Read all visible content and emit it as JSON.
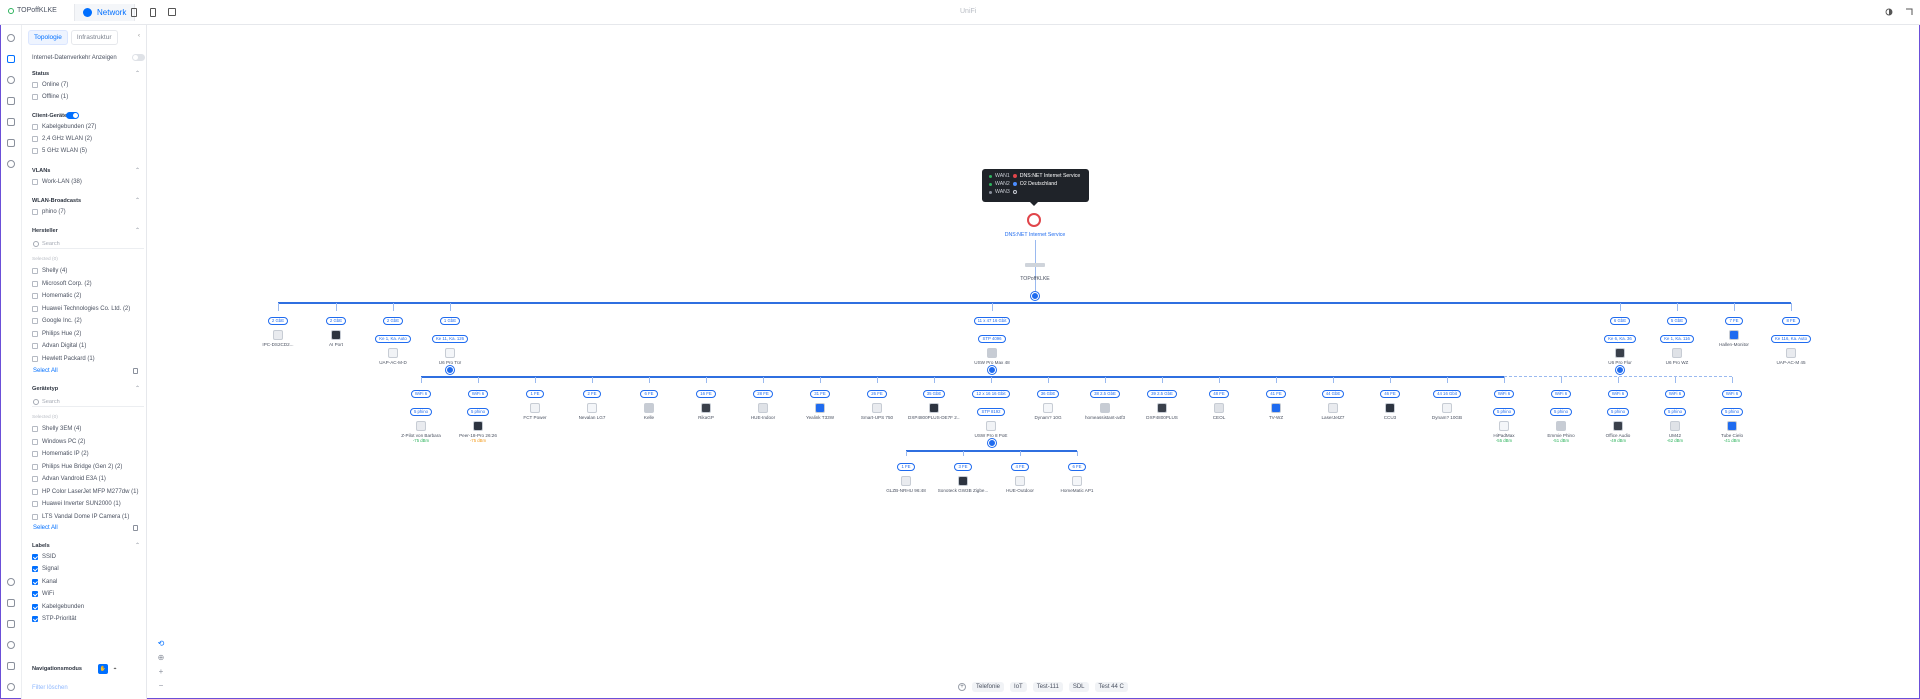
{
  "topbar": {
    "site_name": "TOPoffKLKE",
    "app_name": "Network",
    "center_title": "UniFi"
  },
  "panel": {
    "tabs": [
      "Topologie",
      "Infrastruktur"
    ],
    "internet_traffic_label": "Internet-Datenverkehr Anzeigen",
    "sections": {
      "status": {
        "title": "Status",
        "items": [
          "Online (7)",
          "Offline (1)"
        ]
      },
      "clients": {
        "title": "Client-Geräte",
        "items": [
          "Kabelgebunden (27)",
          "2,4 GHz WLAN (2)",
          "5 GHz WLAN (5)"
        ]
      },
      "vlans": {
        "title": "VLANs",
        "items": [
          "Work-LAN (38)"
        ]
      },
      "wlan": {
        "title": "WLAN-Broadcasts",
        "items": [
          "phino (7)"
        ]
      },
      "manufacturer": {
        "title": "Hersteller",
        "search_placeholder": "Search",
        "selected": "Selected (0)",
        "items": [
          "Shelly (4)",
          "Microsoft Corp. (2)",
          "Homematic (2)",
          "Huawei Technologies Co. Ltd. (2)",
          "Google Inc. (2)",
          "Philips Hue (2)",
          "Advan Digital (1)",
          "Hewlett Packard (1)"
        ],
        "select_all": "Select All"
      },
      "devicetype": {
        "title": "Gerätetyp",
        "search_placeholder": "Search",
        "selected": "Selected (0)",
        "items": [
          "Shelly 3EM (4)",
          "Windows PC (2)",
          "Homematic IP (2)",
          "Philips Hue Bridge (Gen 2) (2)",
          "Advan Vandroid E3A (1)",
          "HP Color LaserJet MFP M277dw (1)",
          "Huawei Inverter SUN2000 (1)",
          "LTS Vandal Dome IP Camera (1)"
        ],
        "select_all": "Select All"
      },
      "labels": {
        "title": "Labels",
        "items": [
          "SSID",
          "Signal",
          "Kanal",
          "WiFi",
          "Kabelgebunden",
          "STP-Priorität"
        ]
      }
    },
    "nav_mode_label": "Navigationsmodus",
    "filter_clear": "Filter löschen"
  },
  "wan": {
    "rows": [
      {
        "key": "WAN1",
        "value": "DNS:NET Internet Service"
      },
      {
        "key": "WAN2",
        "value": "O2 Deutschland"
      },
      {
        "key": "WAN3",
        "value": ""
      }
    ],
    "isp_name": "DNS:NET Internet Service",
    "gateway_name": "TOPoffKLKE"
  },
  "tier1": [
    {
      "pills": [
        "2 GbE"
      ],
      "name": "IPC-DS2CD2...",
      "sig": ""
    },
    {
      "pills": [
        "2 GbE"
      ],
      "name": "AI Port",
      "sig": ""
    },
    {
      "pills": [
        "2 GbE",
        "Ke 1, Ka. Auto"
      ],
      "name": "UAP-AC-M-D",
      "sig": ""
    },
    {
      "pills": [
        "1 GbE",
        "Ke 11, Ka. 126"
      ],
      "name": "U6 Pro Tür",
      "sig": ""
    },
    {
      "pills": [
        "11 x 47 16 Gbit",
        "STP 4096"
      ],
      "name": "USW Pro Max 48",
      "sig": ""
    },
    {
      "pills": [
        "6 GbE",
        "Ke 6, Ka. 36"
      ],
      "name": "U6 Pro Flur",
      "sig": ""
    },
    {
      "pills": [
        "5 GbE",
        "Ke 1, Ka. 116"
      ],
      "name": "U6 Pro WZ",
      "sig": ""
    },
    {
      "pills": [
        "7 FE"
      ],
      "name": "Hallen-Monitor",
      "sig": ""
    },
    {
      "pills": [
        "8 FE",
        "Ke 116, Ka. Auto"
      ],
      "name": "UAP-AC-M 45",
      "sig": ""
    }
  ],
  "tier2": [
    {
      "pills": [
        "WiFi 6",
        "5 phino"
      ],
      "name": "Z-Pilot von Barbara",
      "sig": "-75 dBm",
      "sig_color": "green"
    },
    {
      "pills": [
        "WiFi 6",
        "5 phino"
      ],
      "name": "Peer-18-Pro 26:26",
      "sig": "-75 dBm",
      "sig_color": "orange"
    },
    {
      "pills": [
        "1 FE"
      ],
      "name": "FCT Power",
      "sig": ""
    },
    {
      "pills": [
        "2 FE"
      ],
      "name": "Nevalan LG7",
      "sig": ""
    },
    {
      "pills": [
        "6 FE"
      ],
      "name": "Kelle",
      "sig": ""
    },
    {
      "pills": [
        "16 FE"
      ],
      "name": "RikaGP",
      "sig": ""
    },
    {
      "pills": [
        "28 FE"
      ],
      "name": "HUE-Indoor",
      "sig": ""
    },
    {
      "pills": [
        "31 FE"
      ],
      "name": "Yealink T33W",
      "sig": ""
    },
    {
      "pills": [
        "26 FE"
      ],
      "name": "Smart-UPS 750",
      "sig": ""
    },
    {
      "pills": [
        "35 GbE"
      ],
      "name": "DXP4800PLUS-DE7F 2...",
      "sig": ""
    },
    {
      "pills": [
        "12 x 16 16 Gbit",
        "STP 8192"
      ],
      "name": "USW Pro 8 PoE",
      "sig": ""
    },
    {
      "pills": [
        "36 GbE"
      ],
      "name": "Dynam? 10G",
      "sig": ""
    },
    {
      "pills": [
        "38 2.5 GbE"
      ],
      "name": "homeassistant-a4f3",
      "sig": ""
    },
    {
      "pills": [
        "39 2.5 GbE"
      ],
      "name": "DXP4800PLUS",
      "sig": ""
    },
    {
      "pills": [
        "48 FE"
      ],
      "name": "CEOL",
      "sig": ""
    },
    {
      "pills": [
        "41 FE"
      ],
      "name": "TV-WZ",
      "sig": ""
    },
    {
      "pills": [
        "44 GbE"
      ],
      "name": "LaserJetZ7",
      "sig": ""
    },
    {
      "pills": [
        "46 FE"
      ],
      "name": "CCU3",
      "sig": ""
    },
    {
      "pills": [
        "44 16 Gbit"
      ],
      "name": "Dynam? 10GB",
      "sig": ""
    },
    {
      "pills": [
        "WiFi 6",
        "5 phino"
      ],
      "name": "HiPadMax",
      "sig": "-55 dBm",
      "sig_color": "green"
    },
    {
      "pills": [
        "WiFi 6",
        "5 phino"
      ],
      "name": "Emmie Phino",
      "sig": "-51 dBm",
      "sig_color": "green"
    },
    {
      "pills": [
        "WiFi 6",
        "5 phino"
      ],
      "name": "Office Audio",
      "sig": "-49 dBm",
      "sig_color": "green"
    },
    {
      "pills": [
        "WiFi 6",
        "5 phino"
      ],
      "name": "UM42",
      "sig": "-62 dBm",
      "sig_color": "green"
    },
    {
      "pills": [
        "WiFi 6",
        "5 phino"
      ],
      "name": "Tube Cielo",
      "sig": "-41 dBm",
      "sig_color": "green"
    }
  ],
  "tier3": [
    {
      "pills": [
        "1 FE"
      ],
      "name": "GLZB-NRHU 96:48"
    },
    {
      "pills": [
        "3 FE"
      ],
      "name": "Sonoteck GW3B Zigbe..."
    },
    {
      "pills": [
        "4 FE"
      ],
      "name": "HUE-Outdoor"
    },
    {
      "pills": [
        "6 FE"
      ],
      "name": "HomeMatic AP1"
    }
  ],
  "bottombar": [
    "Telefonie",
    "IoT",
    "Test-111",
    "SDL",
    "Test 44 C"
  ],
  "colors": {
    "accent": "#006fff",
    "line": "#2f6fe0",
    "signal_good": "#2db35d",
    "signal_warn": "#f39a1b",
    "isp": "#e0454a"
  }
}
